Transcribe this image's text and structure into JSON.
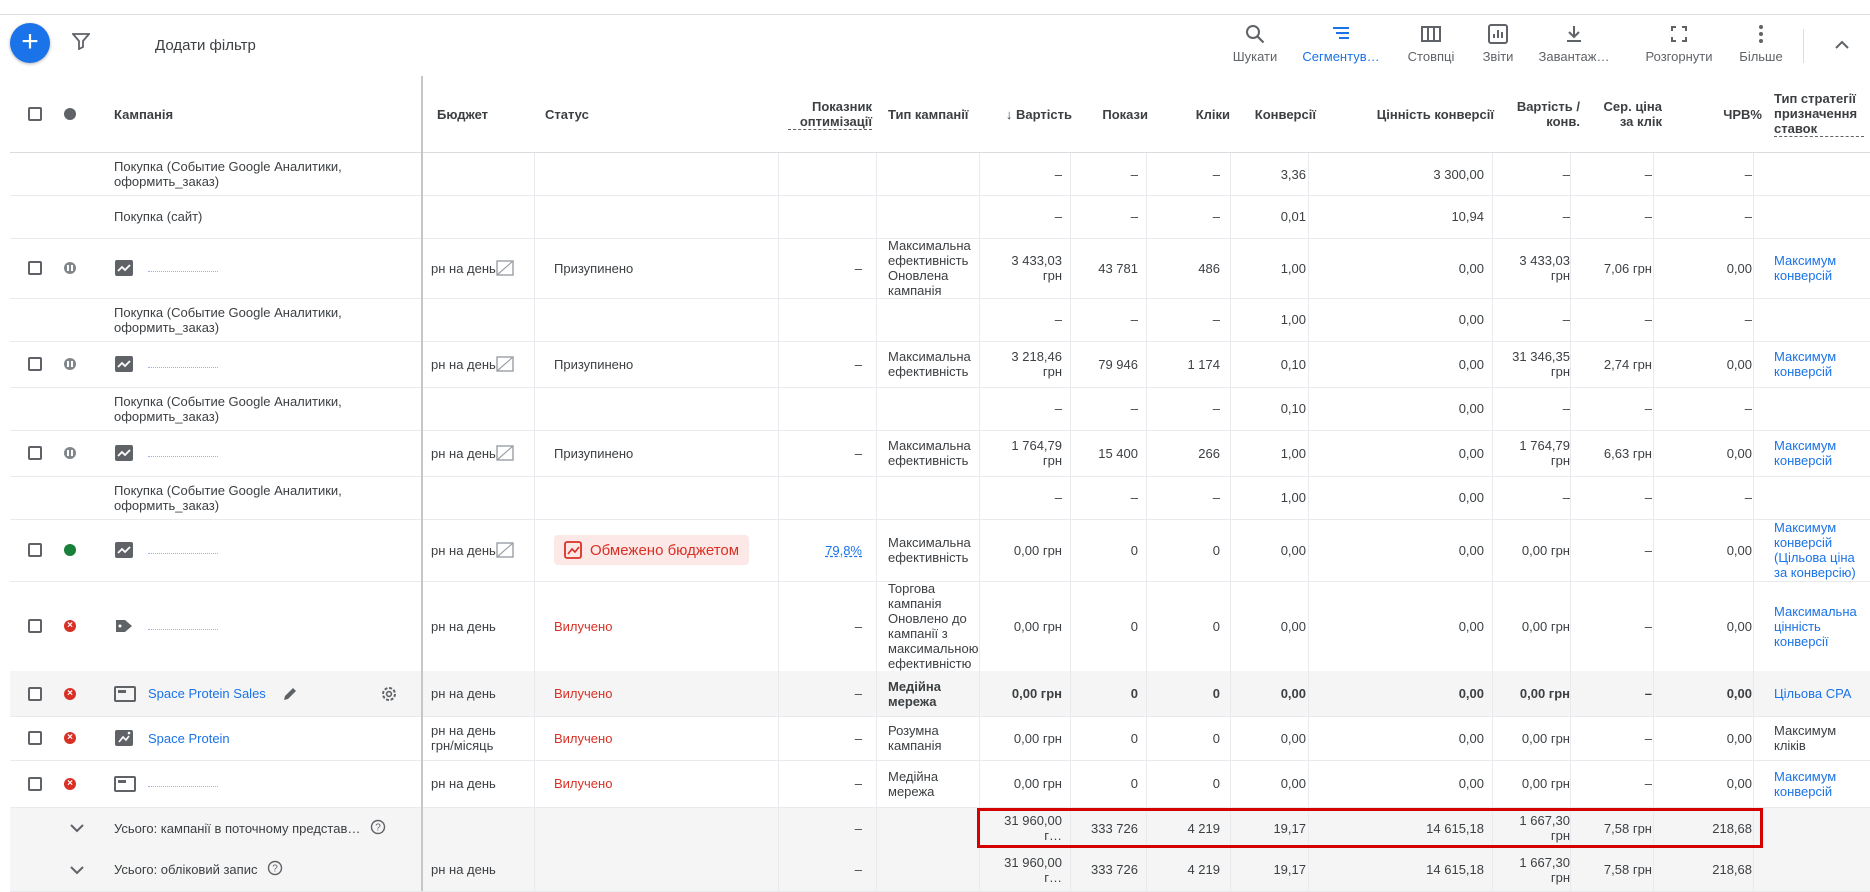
{
  "toolbar": {
    "add_filter": "Додати фільтр",
    "buttons": [
      {
        "label": "Шукати",
        "icon": "search-icon"
      },
      {
        "label": "Сегментув…",
        "icon": "segment-icon"
      },
      {
        "label": "Стовпці",
        "icon": "columns-icon"
      },
      {
        "label": "Звіти",
        "icon": "reports-icon"
      },
      {
        "label": "Завантаж…",
        "icon": "download-icon"
      },
      {
        "label": "Розгорнути",
        "icon": "expand-icon"
      },
      {
        "label": "Більше",
        "icon": "more-icon"
      }
    ]
  },
  "columns": {
    "campaign": "Кампанія",
    "budget": "Бюджет",
    "status": "Статус",
    "opt_score": "Показник оптимізації",
    "type": "Тип кампанії",
    "cost": "↓ Вартість",
    "impr": "Покази",
    "clicks": "Кліки",
    "conv": "Конверсії",
    "conv_value": "Цінність конверсії",
    "cost_conv": "Вартість / конв.",
    "avg_cpc": "Сер. ціна за клік",
    "ctr": "ЧРВ%",
    "bid": "Тип стратегії призначення ставок"
  },
  "rows": [
    {
      "kind": "sub",
      "name": "Покупка (Событие Google Аналитики, оформить_заказ)",
      "cost": "–",
      "impr": "–",
      "clicks": "–",
      "conv": "3,36",
      "conv_value": "3 300,00",
      "cost_conv": "–",
      "avg_cpc": "–",
      "ctr": "–"
    },
    {
      "kind": "sub",
      "name": "Покупка (сайт)",
      "cost": "–",
      "impr": "–",
      "clicks": "–",
      "conv": "0,01",
      "conv_value": "10,94",
      "cost_conv": "–",
      "avg_cpc": "–",
      "ctr": "–"
    },
    {
      "kind": "camp",
      "status": "paused",
      "budget": "рн на день",
      "status_text": "Призупинено",
      "opt": "–",
      "type": "Максимальна ефективність Оновлена кампанія",
      "cost": "3 433,03 грн",
      "impr": "43 781",
      "clicks": "486",
      "conv": "1,00",
      "conv_value": "0,00",
      "cost_conv": "3 433,03 грн",
      "avg_cpc": "7,06 грн",
      "ctr": "0,00",
      "bid": "Максимум конверсій"
    },
    {
      "kind": "sub",
      "name": "Покупка (Событие Google Аналитики, оформить_заказ)",
      "cost": "–",
      "impr": "–",
      "clicks": "–",
      "conv": "1,00",
      "conv_value": "0,00",
      "cost_conv": "–",
      "avg_cpc": "–",
      "ctr": "–"
    },
    {
      "kind": "camp",
      "status": "paused",
      "budget": "рн на день",
      "status_text": "Призупинено",
      "opt": "–",
      "type": "Максимальна ефективність",
      "cost": "3 218,46 грн",
      "impr": "79 946",
      "clicks": "1 174",
      "conv": "0,10",
      "conv_value": "0,00",
      "cost_conv": "31 346,35 грн",
      "avg_cpc": "2,74 грн",
      "ctr": "0,00",
      "bid": "Максимум конверсій"
    },
    {
      "kind": "sub",
      "name": "Покупка (Событие Google Аналитики, оформить_заказ)",
      "cost": "–",
      "impr": "–",
      "clicks": "–",
      "conv": "0,10",
      "conv_value": "0,00",
      "cost_conv": "–",
      "avg_cpc": "–",
      "ctr": "–"
    },
    {
      "kind": "camp",
      "status": "paused",
      "budget": "рн на день",
      "status_text": "Призупинено",
      "opt": "–",
      "type": "Максимальна ефективність",
      "cost": "1 764,79 грн",
      "impr": "15 400",
      "clicks": "266",
      "conv": "1,00",
      "conv_value": "0,00",
      "cost_conv": "1 764,79 грн",
      "avg_cpc": "6,63 грн",
      "ctr": "0,00",
      "bid": "Максимум конверсій"
    },
    {
      "kind": "sub",
      "name": "Покупка (Событие Google Аналитики, оформить_заказ)",
      "cost": "–",
      "impr": "–",
      "clicks": "–",
      "conv": "1,00",
      "conv_value": "0,00",
      "cost_conv": "–",
      "avg_cpc": "–",
      "ctr": "–"
    },
    {
      "kind": "camp",
      "status": "active",
      "budget": "рн на день",
      "status_text": "Обмежено бюджетом",
      "opt": "79,8%",
      "type": "Максимальна ефективність",
      "cost": "0,00 грн",
      "impr": "0",
      "clicks": "0",
      "conv": "0,00",
      "conv_value": "0,00",
      "cost_conv": "0,00 грн",
      "avg_cpc": "–",
      "ctr": "0,00",
      "bid": "Максимум конверсій (Цільова ціна за конверсію)"
    },
    {
      "kind": "camp",
      "status": "removed",
      "budget": "рн на день",
      "status_text": "Вилучено",
      "opt": "–",
      "type": "Торгова кампанія Оновлено до кампанії з максимальною ефективністю",
      "cost": "0,00 грн",
      "impr": "0",
      "clicks": "0",
      "conv": "0,00",
      "conv_value": "0,00",
      "cost_conv": "0,00 грн",
      "avg_cpc": "–",
      "ctr": "0,00",
      "bid": "Максимальна цінність конверсії"
    },
    {
      "kind": "camp",
      "status": "removed",
      "name": "Space Protein Sales",
      "budget": "рн на день",
      "status_text": "Вилучено",
      "opt": "–",
      "type": "Медійна мережа",
      "cost": "0,00 грн",
      "impr": "0",
      "clicks": "0",
      "conv": "0,00",
      "conv_value": "0,00",
      "cost_conv": "0,00 грн",
      "avg_cpc": "–",
      "ctr": "0,00",
      "bid": "Цільова CPA"
    },
    {
      "kind": "camp",
      "status": "removed",
      "name": "Space Protein",
      "budget": "рн на день",
      "budget2": "грн/місяць",
      "status_text": "Вилучено",
      "opt": "–",
      "type": "Розумна кампанія",
      "cost": "0,00 грн",
      "impr": "0",
      "clicks": "0",
      "conv": "0,00",
      "conv_value": "0,00",
      "cost_conv": "0,00 грн",
      "avg_cpc": "–",
      "ctr": "0,00",
      "bid": "Максимум кліків"
    },
    {
      "kind": "camp",
      "status": "removed",
      "budget": "рн на день",
      "status_text": "Вилучено",
      "opt": "–",
      "type": "Медійна мережа",
      "cost": "0,00 грн",
      "impr": "0",
      "clicks": "0",
      "conv": "0,00",
      "conv_value": "0,00",
      "cost_conv": "0,00 грн",
      "avg_cpc": "–",
      "ctr": "0,00",
      "bid": "Максимум конверсій"
    }
  ],
  "totals": [
    {
      "label": "Усього: кампанії в поточному представ…",
      "budget": "",
      "opt": "–",
      "cost": "31 960,00 г…",
      "impr": "333 726",
      "clicks": "4 219",
      "conv": "19,17",
      "conv_value": "14 615,18",
      "cost_conv": "1 667,30 грн",
      "avg_cpc": "7,58 грн",
      "ctr": "218,68"
    },
    {
      "label": "Усього: обліковий запис",
      "budget": "рн на день",
      "opt": "–",
      "cost": "31 960,00 г…",
      "impr": "333 726",
      "clicks": "4 219",
      "conv": "19,17",
      "conv_value": "14 615,18",
      "cost_conv": "1 667,30 грн",
      "avg_cpc": "7,58 грн",
      "ctr": "218,68"
    }
  ]
}
